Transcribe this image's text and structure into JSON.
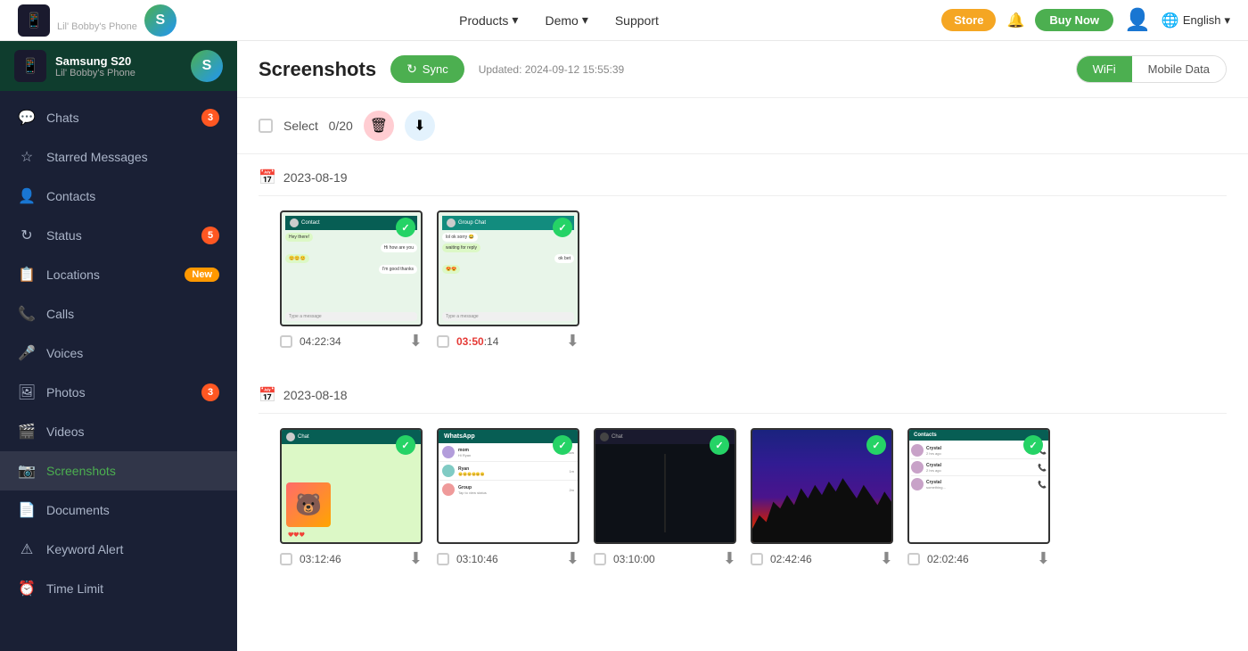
{
  "topnav": {
    "device": {
      "model": "Samsung S20",
      "phone_label": "Lil' Bobby's Phone"
    },
    "nav_items": [
      {
        "label": "Products",
        "has_dropdown": true
      },
      {
        "label": "Demo",
        "has_dropdown": true
      },
      {
        "label": "Support",
        "has_dropdown": false
      }
    ],
    "store_label": "Store",
    "buy_now_label": "Buy Now",
    "language": "English"
  },
  "sidebar": {
    "device": {
      "model": "Samsung S20",
      "phone_label": "Lil' Bobby's Phone",
      "avatar_letter": "S"
    },
    "items": [
      {
        "id": "chats",
        "label": "Chats",
        "icon": "💬",
        "badge": "3"
      },
      {
        "id": "starred",
        "label": "Starred Messages",
        "icon": "☆",
        "badge": null
      },
      {
        "id": "contacts",
        "label": "Contacts",
        "icon": "👤",
        "badge": null
      },
      {
        "id": "status",
        "label": "Status",
        "icon": "↻",
        "badge": "5"
      },
      {
        "id": "locations",
        "label": "Locations",
        "icon": "📋",
        "badge": null,
        "badge_new": "New"
      },
      {
        "id": "calls",
        "label": "Calls",
        "icon": "📞",
        "badge": null
      },
      {
        "id": "voices",
        "label": "Voices",
        "icon": "🎤",
        "badge": null
      },
      {
        "id": "photos",
        "label": "Photos",
        "icon": "🖼",
        "badge": "3"
      },
      {
        "id": "videos",
        "label": "Videos",
        "icon": "🎬",
        "badge": null
      },
      {
        "id": "screenshots",
        "label": "Screenshots",
        "icon": "📷",
        "badge": null,
        "active": true
      },
      {
        "id": "documents",
        "label": "Documents",
        "icon": "📄",
        "badge": null
      },
      {
        "id": "keyword-alert",
        "label": "Keyword Alert",
        "icon": "⚠",
        "badge": null
      },
      {
        "id": "time-limit",
        "label": "Time Limit",
        "icon": "⏰",
        "badge": null
      }
    ]
  },
  "content": {
    "title": "Screenshots",
    "sync_label": "Sync",
    "updated_text": "Updated: 2024-09-12 15:55:39",
    "select_label": "Select",
    "select_count": "0/20",
    "wifi_label": "WiFi",
    "mobile_data_label": "Mobile Data",
    "date_groups": [
      {
        "date": "2023-08-19",
        "screenshots": [
          {
            "time": "04:22:34",
            "has_whatsapp": true,
            "type": "chat1"
          },
          {
            "time": "03:50:14",
            "has_whatsapp": true,
            "type": "chat2"
          }
        ]
      },
      {
        "date": "2023-08-18",
        "screenshots": [
          {
            "time": "03:12:46",
            "has_whatsapp": true,
            "type": "sticker"
          },
          {
            "time": "03:10:46",
            "has_whatsapp": true,
            "type": "chatlist"
          },
          {
            "time": "03:10:00",
            "has_whatsapp": true,
            "type": "dark"
          },
          {
            "time": "02:42:46",
            "has_whatsapp": true,
            "type": "city"
          },
          {
            "time": "02:02:46",
            "has_whatsapp": true,
            "type": "contacts"
          }
        ]
      }
    ]
  }
}
